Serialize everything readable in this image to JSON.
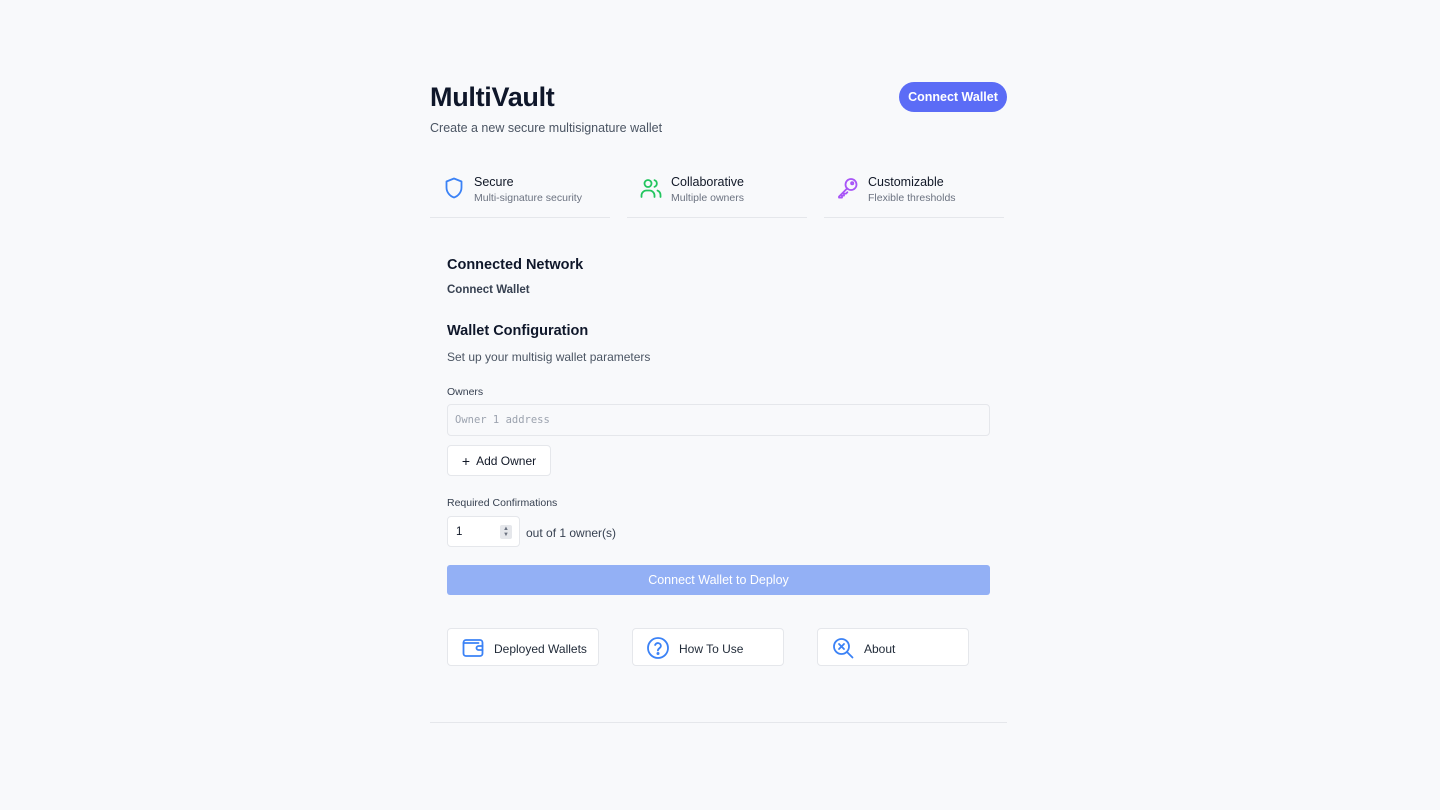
{
  "header": {
    "title": "MultiVault",
    "subtitle": "Create a new secure multisignature wallet",
    "connect_label": "Connect Wallet"
  },
  "features": [
    {
      "title": "Secure",
      "subtitle": "Multi-signature security",
      "icon": "shield-icon",
      "color": "#3b82f6"
    },
    {
      "title": "Collaborative",
      "subtitle": "Multiple owners",
      "icon": "users-icon",
      "color": "#22c55e"
    },
    {
      "title": "Customizable",
      "subtitle": "Flexible thresholds",
      "icon": "key-icon",
      "color": "#a855f7"
    }
  ],
  "network": {
    "heading": "Connected Network",
    "status": "Connect Wallet"
  },
  "config": {
    "heading": "Wallet Configuration",
    "subtitle": "Set up your multisig wallet parameters",
    "owners_label": "Owners",
    "owner_placeholder": "Owner 1 address",
    "owner_value": "",
    "add_owner_label": "Add Owner",
    "confirmations_label": "Required Confirmations",
    "confirmations_value": "1",
    "out_of_text": "out of 1 owner(s)",
    "deploy_label": "Connect Wallet to Deploy"
  },
  "nav": [
    {
      "label": "Deployed Wallets",
      "icon": "wallet-icon"
    },
    {
      "label": "How To Use",
      "icon": "help-circle-icon"
    },
    {
      "label": "About",
      "icon": "search-x-icon"
    }
  ],
  "colors": {
    "accent": "#5b6cf6",
    "deploy_disabled": "#93b0f5",
    "icon_blue": "#3b82f6"
  }
}
